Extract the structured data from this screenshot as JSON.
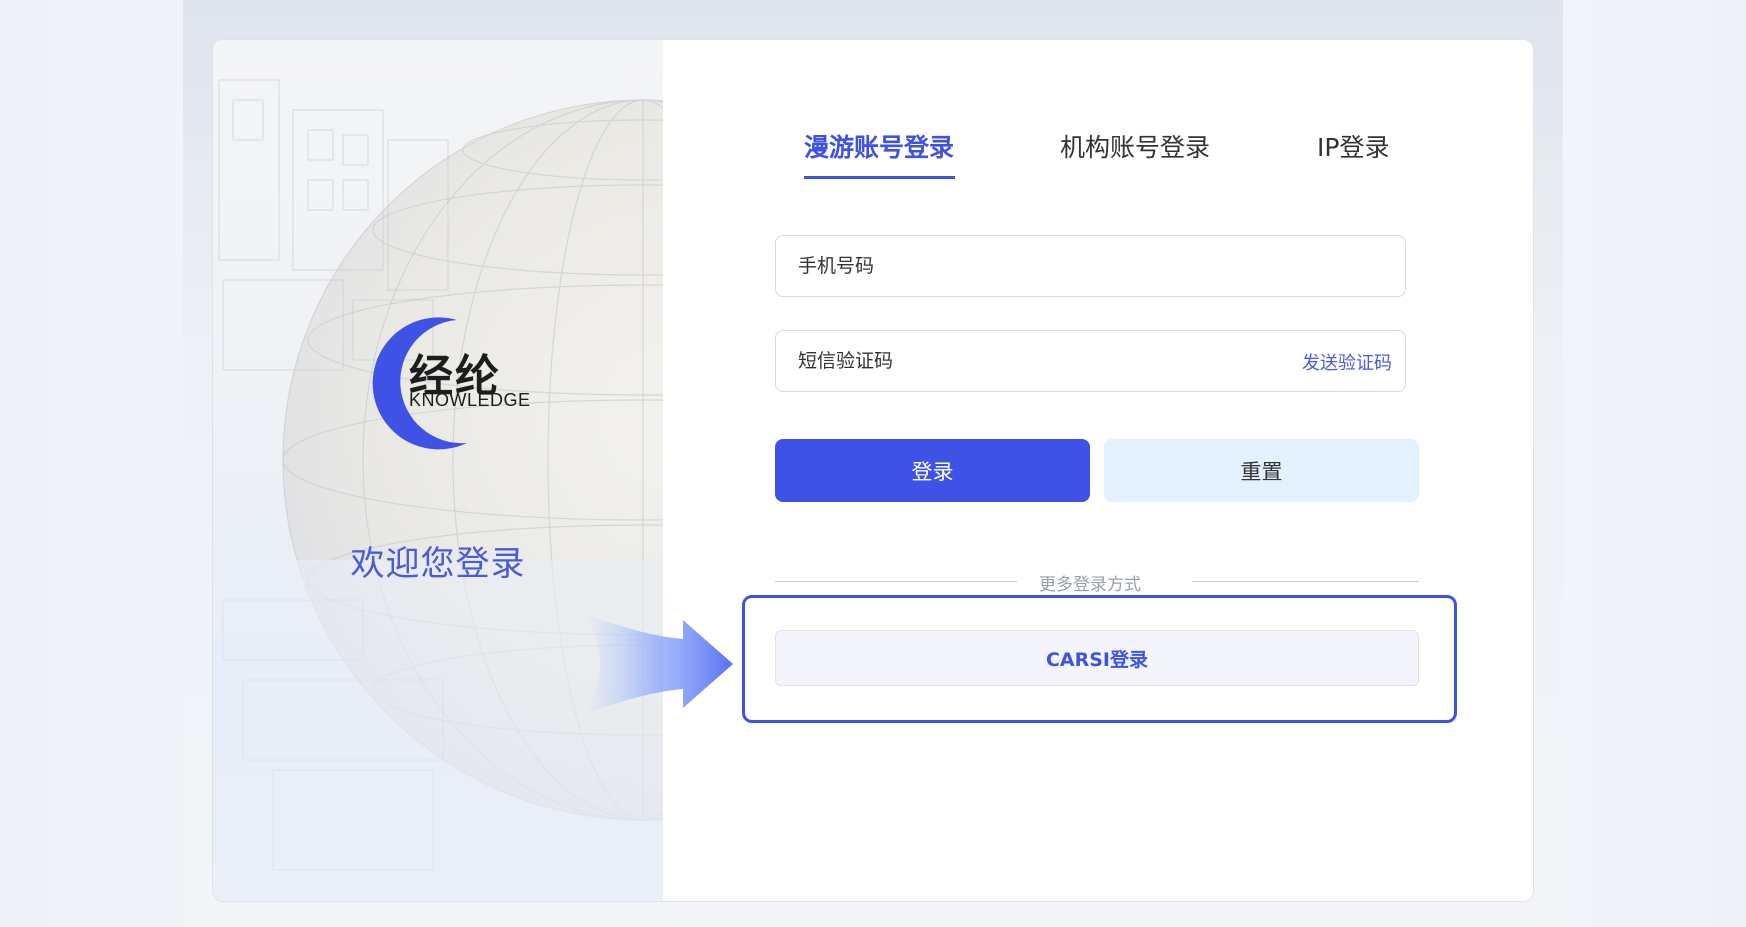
{
  "brand": {
    "name_cn": "经纶",
    "name_en": "KNOWLEDGE",
    "logo_icon": "crescent-logo-icon",
    "color": "#3e53e6"
  },
  "welcome_text": "欢迎您登录",
  "tabs": [
    {
      "label": "漫游账号登录",
      "active": true
    },
    {
      "label": "机构账号登录",
      "active": false
    },
    {
      "label": "IP登录",
      "active": false
    }
  ],
  "form": {
    "phone_placeholder": "手机号码",
    "code_placeholder": "短信验证码",
    "send_code_label": "发送验证码",
    "login_label": "登录",
    "reset_label": "重置"
  },
  "more_methods": {
    "divider_label": "更多登录方式",
    "carsi_label": "CARSI登录"
  },
  "colors": {
    "accent": "#3e53e6",
    "reset_bg": "#e3f0fd",
    "highlight": "#3e53e6"
  }
}
